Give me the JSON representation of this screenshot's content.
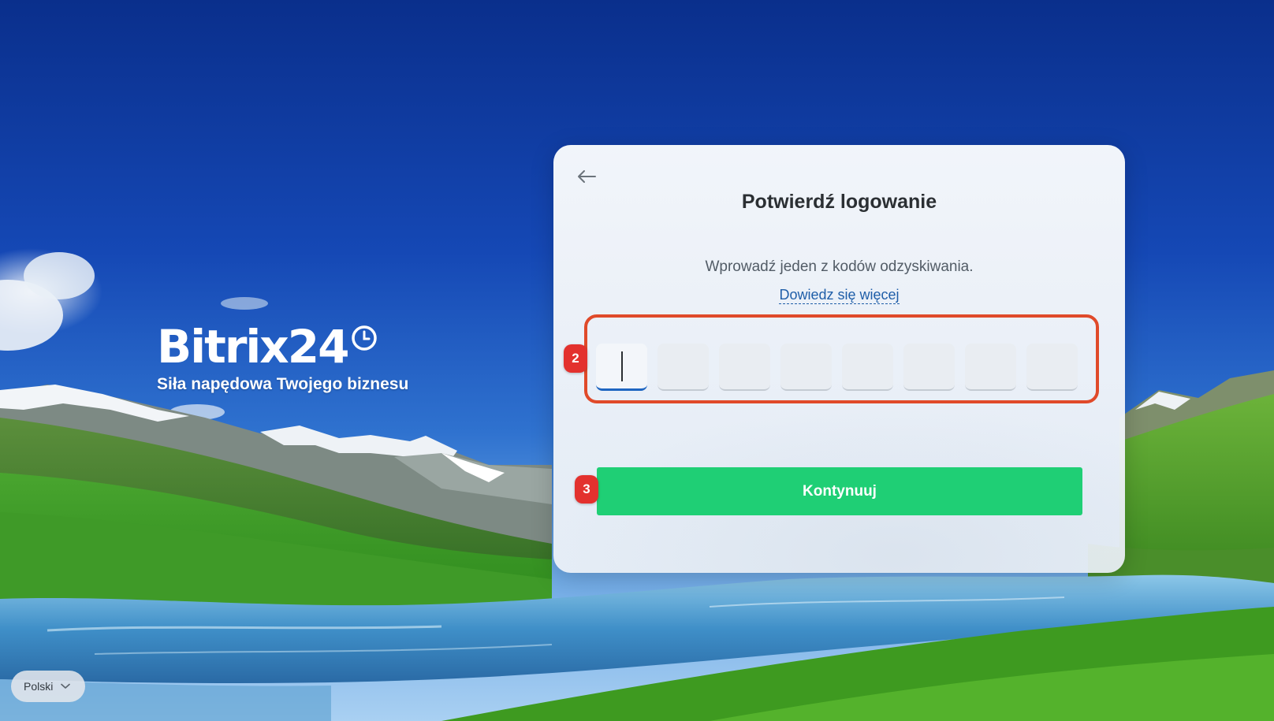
{
  "brand": {
    "name": "Bitrix24",
    "tagline": "Siła napędowa Twojego biznesu"
  },
  "dialog": {
    "title": "Potwierdź logowanie",
    "description": "Wprowadź jeden z kodów odzyskiwania.",
    "learn_more": "Dowiedz się więcej",
    "code_boxes": [
      "",
      "",
      "",
      "",
      "",
      "",
      "",
      ""
    ],
    "active_box_index": 0,
    "continue_label": "Kontynuuj"
  },
  "annotations": {
    "badge_code": "2",
    "badge_continue": "3",
    "highlight_color": "#e04a2a",
    "badge_color": "#e3312e"
  },
  "language": {
    "selected": "Polski"
  },
  "colors": {
    "primary_button": "#1fcf75",
    "link": "#1f5ea8",
    "active_input": "#1f66c1"
  },
  "icons": {
    "back": "arrow-left-icon",
    "clock": "clock-icon",
    "chevron": "chevron-down-icon"
  }
}
